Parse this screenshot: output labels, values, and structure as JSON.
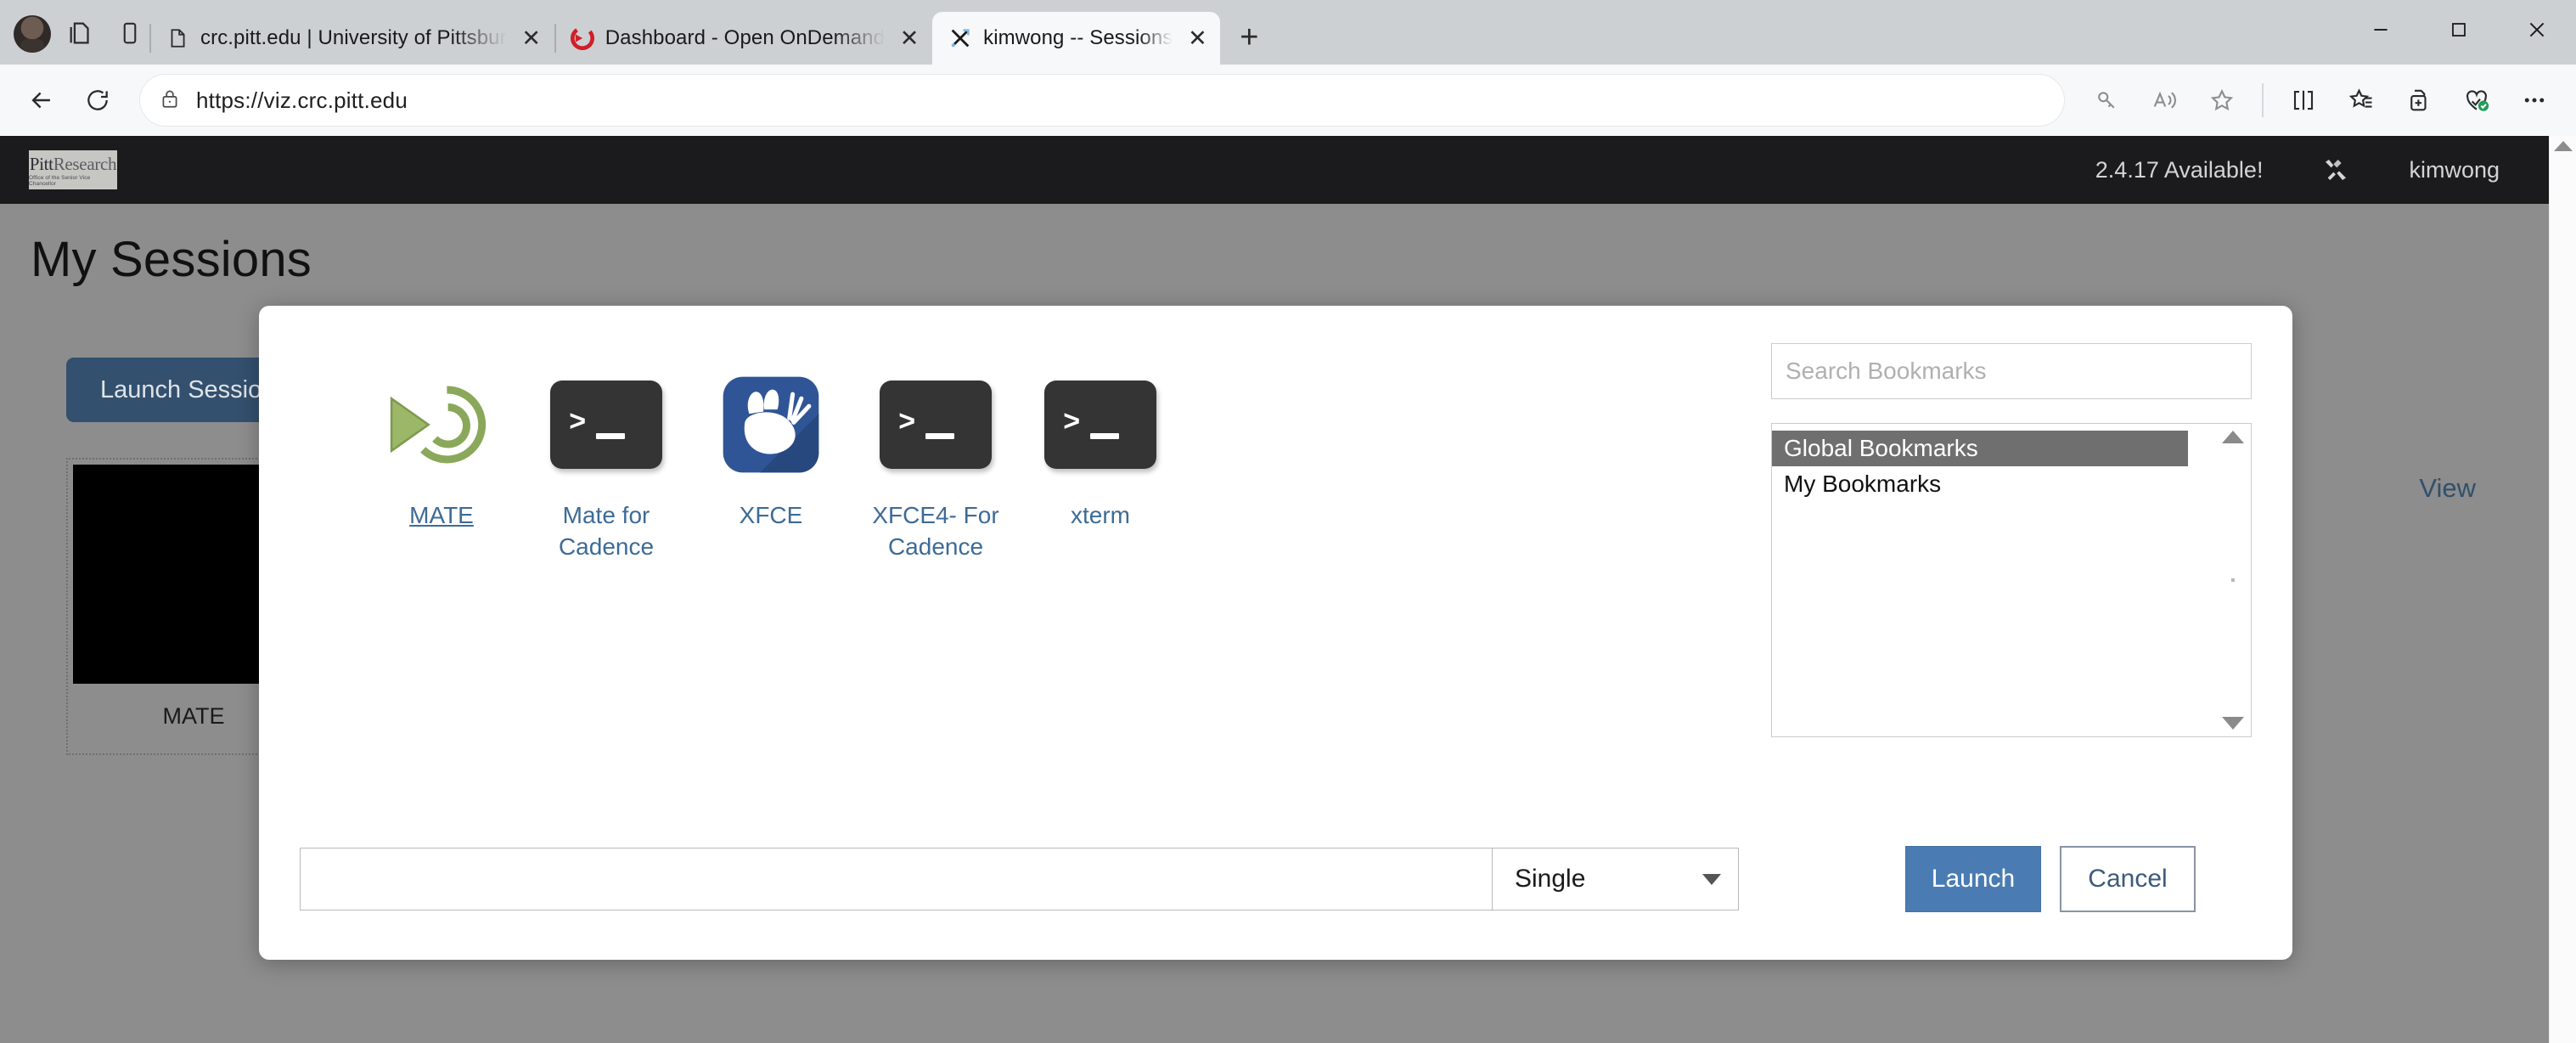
{
  "browser": {
    "tabs": [
      {
        "title": "crc.pitt.edu | University of Pittsbur",
        "favicon": "document-icon",
        "active": false
      },
      {
        "title": "Dashboard - Open OnDemand",
        "favicon": "ondemand-icon",
        "active": false
      },
      {
        "title": "kimwong -- Sessions",
        "favicon": "x-session-icon",
        "active": true
      }
    ],
    "new_tab_label": "+",
    "close_label": "✕",
    "window_controls": {
      "minimize": "minimize-icon",
      "maximize": "maximize-icon",
      "close": "close-icon"
    },
    "nav": {
      "back": "back-arrow-icon",
      "reload": "reload-icon"
    },
    "omnibox": {
      "url": "https://viz.crc.pitt.edu",
      "lock": "lock-icon"
    },
    "toolbar_right_icons": [
      "key-icon",
      "read-aloud-icon",
      "favorite-star-icon",
      "split-screen-icon",
      "collections-icon",
      "add-tab-group-icon",
      "browser-essentials-icon",
      "more-options-icon"
    ]
  },
  "site": {
    "navbar": {
      "brand_primary": "Pitt",
      "brand_secondary": "Research",
      "brand_tagline": "Office of the Senior Vice Chancellor",
      "version_notice": "2.4.17 Available!",
      "tools_icon": "wrench-screwdriver-icon",
      "username": "kimwong"
    },
    "page_title": "My Sessions",
    "launch_session_label": "Launch Session",
    "view_link_label": "View",
    "session_card": {
      "caption": "MATE"
    }
  },
  "modal": {
    "apps": [
      {
        "label": "MATE",
        "icon": "mate-logo-icon",
        "hovered": true
      },
      {
        "label": "Mate for Cadence",
        "icon": "terminal-icon",
        "hovered": false
      },
      {
        "label": "XFCE",
        "icon": "xfce-mouse-icon",
        "hovered": false
      },
      {
        "label": "XFCE4- For Cadence",
        "icon": "terminal-icon",
        "hovered": false
      },
      {
        "label": "xterm",
        "icon": "terminal-icon",
        "hovered": false
      }
    ],
    "bookmarks": {
      "search_placeholder": "Search Bookmarks",
      "items": [
        {
          "label": "Global Bookmarks",
          "selected": true
        },
        {
          "label": "My Bookmarks",
          "selected": false
        }
      ]
    },
    "command_input": {
      "value": "",
      "placeholder": ""
    },
    "session_mode": {
      "selected": "Single",
      "options": [
        "Single"
      ]
    },
    "launch_button": "Launch",
    "cancel_button": "Cancel"
  },
  "colors": {
    "navbar_bg": "#1b1b1d",
    "page_bg": "#8d8d8d",
    "launch_session_bg": "#33506e",
    "launch_bg": "#4a7cb3",
    "link": "#3d6b96",
    "xfce_blue": "#2f5596",
    "mate_green": "#8aa85a",
    "terminal_dark": "#343434",
    "selected_row": "#6f6f6f"
  }
}
